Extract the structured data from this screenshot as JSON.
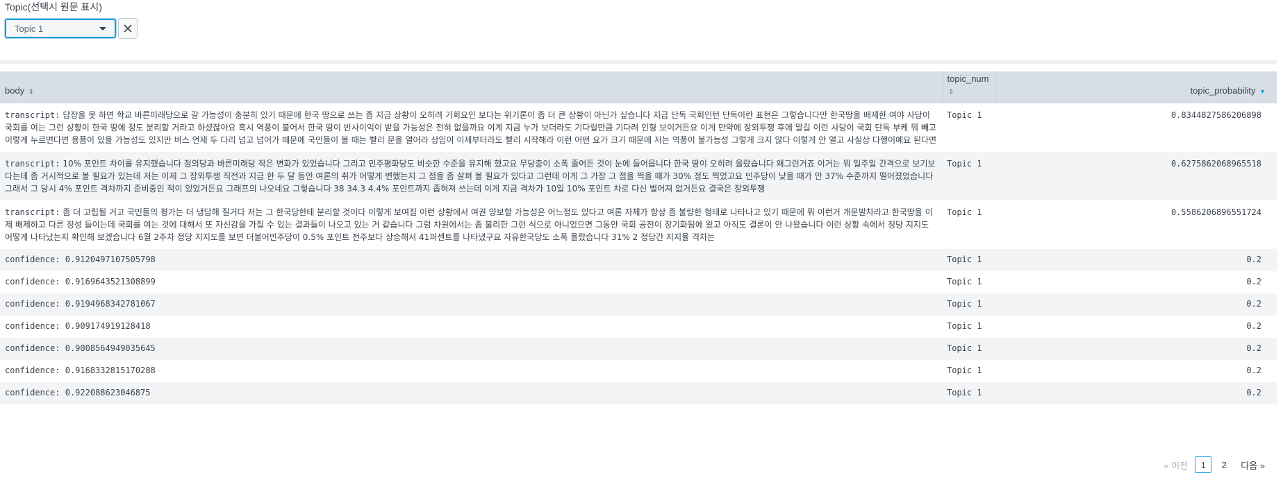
{
  "filter": {
    "label": "Topic(선택시 원문 표시)",
    "selected": "Topic 1",
    "clear_icon": "close-icon"
  },
  "table": {
    "columns": [
      {
        "label": "body",
        "sort": "none"
      },
      {
        "label": "topic_num",
        "sort": "none"
      },
      {
        "label": "topic_probability",
        "sort": "desc"
      }
    ],
    "rows": [
      {
        "key": "transcript:",
        "body": "답장을 못 하면 학교 바른미래당으로 갈 가능성이 충분히 있기 때문에 한국 땅으로 쓰는 좀 지금 상황이 오히려 기회요인 보다는 위기론이 좀 더 큰 상황이 아닌가 싶습니다 지금 단독 국회인턴 단독이란 표현은 그렇습니다만 한국땅을 배제한 여야 사당이 국회를 여는 그런 상황이 한국 땅에 정도 분리할 거라고 하셨잖아요 혹시 역풍이 불어서 한국 땅이 반사이익이 받을 가능성은 전혀 없을까요 이게 지금 누가 보더라도 기다릴만큼 기다려 인형 보이거든요 이게 만약에 장외투쟁 후에 말길 이런 사당이 국회 단독 부케 뭐 빼고 이렇게 누르면다면 용품이 있을 가능성도 있지만 버스 언제 두 다리 넘고 넘어가 때문에 국민들이 볼 때는 빨리 문을 열어라 상임이 이제부터라도 빨리 시작해라 이런 어떤 요가 크기 때문에 저는 역풍이 불가능성 그렇게 크지 않다 이렇게 안 열고 사실상 다행이예요 된다면",
        "topic": "Topic 1",
        "prob": "0.8344827586206898"
      },
      {
        "key": "transcript:",
        "body": "10% 포인트 차이를 유지했습니다 정의당과 바른미래당 작은 변화가 있었습니다 그리고 민주평화당도 비슷한 수준을 유지해 했고요 무당층이 소폭 줄어든 것이 눈에 들어옵니다 한국 땅이 오히려 올랐습니다 왜그런거죠 이거는 뭐 일주일 간격으로 보기보다는데 좀 거시적으로 볼 필요가 있는데 저는 이제 그 장외투쟁 직전과 지금 한 두 달 동안 여론의 취가 어떻게 변했는지 그 점을 좀 살펴 볼 필요가 있다고 그런데 이게 그 가장 그 점을 찍을 때가 30% 정도 찍었고요 민주당이 낮을 때가 안 37% 수준까지 떨어졌었습니다 그래서 그 당시 4% 포인트 격차까지 준비중인 적이 있었거든요 그래프의 나오네요 그렇습니다 38 34.3 4.4% 포인트까지 좁혀져 쓰는데 이게 지금 격차가 10일 10% 포인트 차로 다신 벌어져 없거든요 결국은 장외투쟁",
        "topic": "Topic 1",
        "prob": "0.6275862068965518"
      },
      {
        "key": "transcript:",
        "body": "좀 더 고립될 거고 국민들의 평가는 더 냉담해 질거다 저는 그 한국당한테 분리할 것이다 이렇게 보여짐 이런 상황에서 여권 양보할 가능성은 어느정도 있다고 여론 자체가 항상 좀 불량한 형태로 나타나고 있기 때문에 뭐 이런거 개문발차라고 한국땅을 이제 배제하고 다른 정성 들이는데 국회를 여는 것에 대해서 또 자신감을 가질 수 있는 결과들이 나오고 있는 거 같습니다 그럼 차원에서는 좀 불리한 그런 식으로 아니었으면 그동안 국회 공전이 장기화됨에 왔고 아직도 결론이 안 나왔습니다 이런 상황 속에서 정당 지지도 어떻게 나타났는지 확인해 보겠습니다 6월 2주차 정당 지지도를 보면 더불어민주당이 0.5% 포인트 전주보다 상승해서 41퍼센트를 나타냈구요 자유한국당도 소폭 올랐습니다 31% 2 정당간 지지율 격차는",
        "topic": "Topic 1",
        "prob": "0.5586206896551724"
      },
      {
        "key": "confidence:",
        "body": "0.9120497107505798",
        "topic": "Topic 1",
        "prob": "0.2"
      },
      {
        "key": "confidence:",
        "body": "0.9169643521308899",
        "topic": "Topic 1",
        "prob": "0.2"
      },
      {
        "key": "confidence:",
        "body": "0.9194968342781067",
        "topic": "Topic 1",
        "prob": "0.2"
      },
      {
        "key": "confidence:",
        "body": "0.909174919128418",
        "topic": "Topic 1",
        "prob": "0.2"
      },
      {
        "key": "confidence:",
        "body": "0.9008564949035645",
        "topic": "Topic 1",
        "prob": "0.2"
      },
      {
        "key": "confidence:",
        "body": "0.9168332815170288",
        "topic": "Topic 1",
        "prob": "0.2"
      },
      {
        "key": "confidence:",
        "body": "0.922088623046875",
        "topic": "Topic 1",
        "prob": "0.2"
      }
    ]
  },
  "pagination": {
    "prev": "« 이전",
    "pages": [
      "1",
      "2"
    ],
    "current": "1",
    "next": "다음 »"
  },
  "colors": {
    "accent": "#1a9cd8",
    "header_bg": "#d8dee5",
    "row_stripe": "#f2f4f6"
  }
}
